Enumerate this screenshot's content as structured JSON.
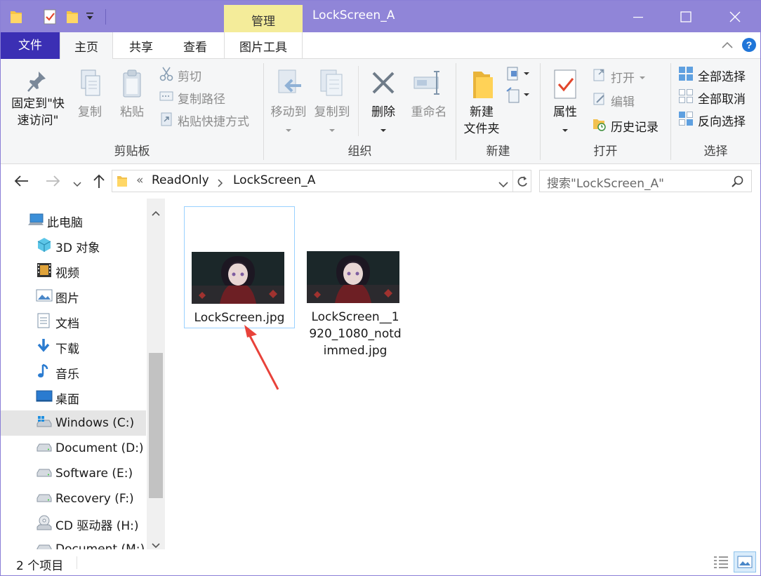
{
  "window": {
    "title": "LockScreen_A",
    "manage_tab": "管理",
    "accent_color": "#9085d8"
  },
  "tabs": {
    "file": "文件",
    "home": "主页",
    "share": "共享",
    "view": "查看",
    "picture_tools": "图片工具"
  },
  "ribbon": {
    "clipboard": {
      "pin_label_1": "固定到\"快",
      "pin_label_2": "速访问\"",
      "copy": "复制",
      "paste": "粘贴",
      "cut": "剪切",
      "copy_path": "复制路径",
      "paste_shortcut": "粘贴快捷方式",
      "group": "剪贴板"
    },
    "organize": {
      "move_to": "移动到",
      "copy_to": "复制到",
      "delete": "删除",
      "rename": "重命名",
      "group": "组织"
    },
    "new": {
      "new_folder_1": "新建",
      "new_folder_2": "文件夹",
      "group": "新建"
    },
    "open": {
      "properties": "属性",
      "open": "打开",
      "edit": "编辑",
      "history": "历史记录",
      "group": "打开"
    },
    "select": {
      "select_all": "全部选择",
      "select_none": "全部取消",
      "invert": "反向选择",
      "group": "选择"
    }
  },
  "address": {
    "overflow": "«",
    "crumb_1": "ReadOnly",
    "crumb_2": "LockScreen_A",
    "search_placeholder": "搜索\"LockScreen_A\""
  },
  "nav": {
    "items": [
      {
        "label": "此电脑",
        "icon": "computer-icon"
      },
      {
        "label": "3D 对象",
        "icon": "3d-objects-icon"
      },
      {
        "label": "视频",
        "icon": "video-icon"
      },
      {
        "label": "图片",
        "icon": "pictures-icon"
      },
      {
        "label": "文档",
        "icon": "documents-icon"
      },
      {
        "label": "下载",
        "icon": "download-icon"
      },
      {
        "label": "音乐",
        "icon": "music-icon"
      },
      {
        "label": "桌面",
        "icon": "desktop-icon"
      },
      {
        "label": "Windows (C:)",
        "icon": "system-drive-icon"
      },
      {
        "label": "Document (D:)",
        "icon": "drive-icon"
      },
      {
        "label": "Software (E:)",
        "icon": "drive-icon"
      },
      {
        "label": "Recovery (F:)",
        "icon": "drive-icon"
      },
      {
        "label": "CD 驱动器 (H:)",
        "icon": "cd-drive-icon"
      },
      {
        "label": "Document (M:)",
        "icon": "drive-icon"
      }
    ]
  },
  "files": [
    {
      "name": "LockScreen.jpg",
      "selected": true
    },
    {
      "name_1": "LockScreen__1",
      "name_2": "920_1080_notd",
      "name_3": "immed.jpg",
      "selected": false
    }
  ],
  "status": {
    "count": "2 个项目"
  }
}
